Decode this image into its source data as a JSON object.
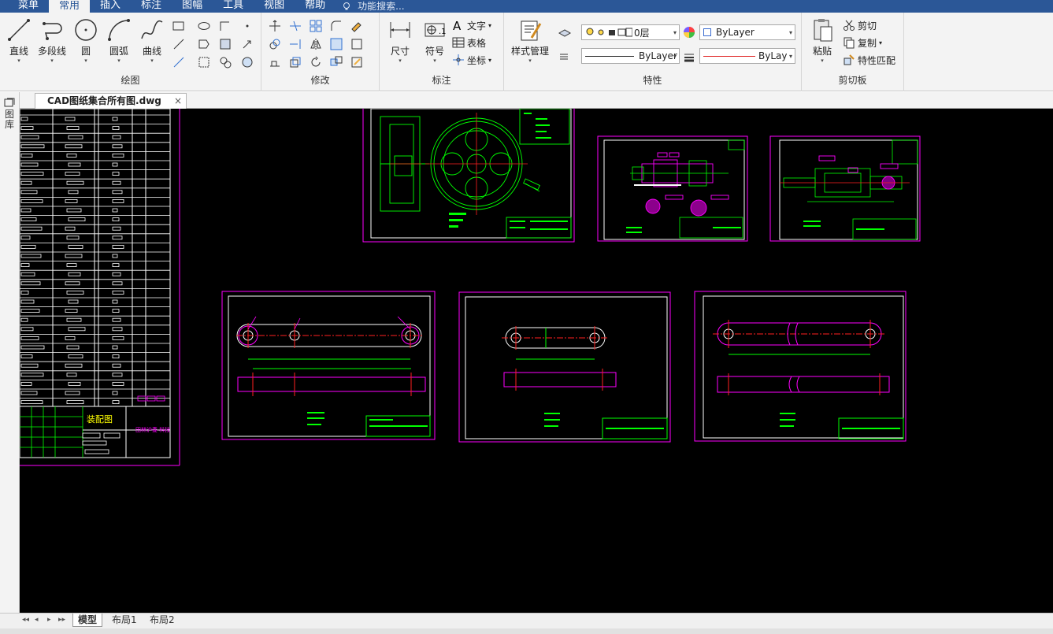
{
  "menu": {
    "tabs": [
      "菜单",
      "常用",
      "插入",
      "标注",
      "图幅",
      "工具",
      "视图",
      "帮助"
    ],
    "active": "常用",
    "search_placeholder": "功能搜索..."
  },
  "ribbon": {
    "draw": {
      "label": "绘图",
      "line": "直线",
      "polyline": "多段线",
      "circle": "圆",
      "arc": "圆弧",
      "curve": "曲线"
    },
    "modify": {
      "label": "修改"
    },
    "annotate": {
      "label": "标注",
      "dimension": "尺寸",
      "symbol": "符号",
      "text": "文字",
      "table": "表格",
      "coordinate": "坐标"
    },
    "properties": {
      "label": "特性",
      "style_manager": "样式管理",
      "layer_value": "0层",
      "color_value": "ByLayer",
      "linetype_value": "ByLayer",
      "lineweight_value": "ByLayer"
    },
    "clipboard": {
      "label": "剪切板",
      "paste": "粘贴",
      "cut": "剪切",
      "copy": "复制",
      "match": "特性匹配"
    }
  },
  "document": {
    "tab_title": "CAD图纸集合所有图.dwg",
    "side_label": "图库"
  },
  "drawing": {
    "title_block_label": "装配图",
    "title_block_sub": "田林沪委 科技"
  },
  "layout_tabs": [
    "模型",
    "布局1",
    "布局2"
  ],
  "colors": {
    "canvas": "#000000",
    "green": "#00ff00",
    "magenta": "#ff00ff",
    "white": "#ffffff",
    "red": "#ff2020",
    "menubar": "#2b5797"
  }
}
